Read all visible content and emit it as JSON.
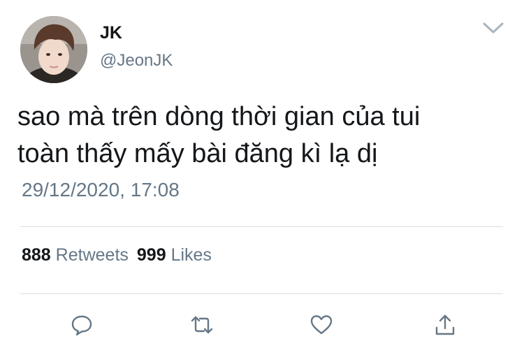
{
  "tweet": {
    "author": {
      "name": "JK",
      "handle": "@JeonJK",
      "avatar_icon": "profile-photo"
    },
    "text": "sao mà trên dòng thời gian của tui\ntoàn thấy mấy bài đăng kì lạ dị",
    "timestamp": "29/12/2020, 17:08",
    "stats": {
      "retweets_count": "888",
      "retweets_label": "Retweets",
      "likes_count": "999",
      "likes_label": "Likes"
    },
    "actions": {
      "reply_icon": "speech-bubble-icon",
      "retweet_icon": "retweet-arrows-icon",
      "like_icon": "heart-icon",
      "share_icon": "share-upload-icon"
    },
    "menu_icon": "chevron-down-icon"
  },
  "colors": {
    "text_primary": "#14171a",
    "text_secondary": "#657786",
    "divider": "#d9dee2",
    "icon": "#657786"
  }
}
